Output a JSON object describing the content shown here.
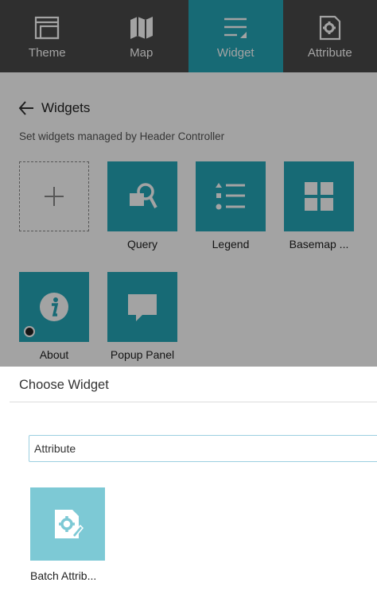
{
  "nav": {
    "tabs": [
      {
        "label": "Theme",
        "icon": "theme-icon",
        "active": false
      },
      {
        "label": "Map",
        "icon": "map-icon",
        "active": false
      },
      {
        "label": "Widget",
        "icon": "widget-icon",
        "active": true
      },
      {
        "label": "Attribute",
        "icon": "attribute-icon",
        "active": false
      }
    ]
  },
  "panel": {
    "title": "Widgets",
    "subtitle": "Set widgets managed by Header Controller",
    "widgets": [
      {
        "label": "",
        "icon": "plus-icon",
        "type": "add"
      },
      {
        "label": "Query",
        "icon": "query-icon"
      },
      {
        "label": "Legend",
        "icon": "legend-icon"
      },
      {
        "label": "Basemap ...",
        "icon": "basemap-icon"
      },
      {
        "label": "About",
        "icon": "info-icon"
      },
      {
        "label": "Popup Panel",
        "icon": "popup-icon"
      }
    ]
  },
  "modal": {
    "title": "Choose Widget",
    "search_value": "Attribute",
    "results": [
      {
        "label": "Batch Attrib...",
        "icon": "batch-attribute-icon"
      }
    ]
  },
  "colors": {
    "nav_bg": "#4a4a4a",
    "active_tab": "#24a6b8",
    "tile": "#24a6b8",
    "result_tile": "#7dc9d5"
  }
}
